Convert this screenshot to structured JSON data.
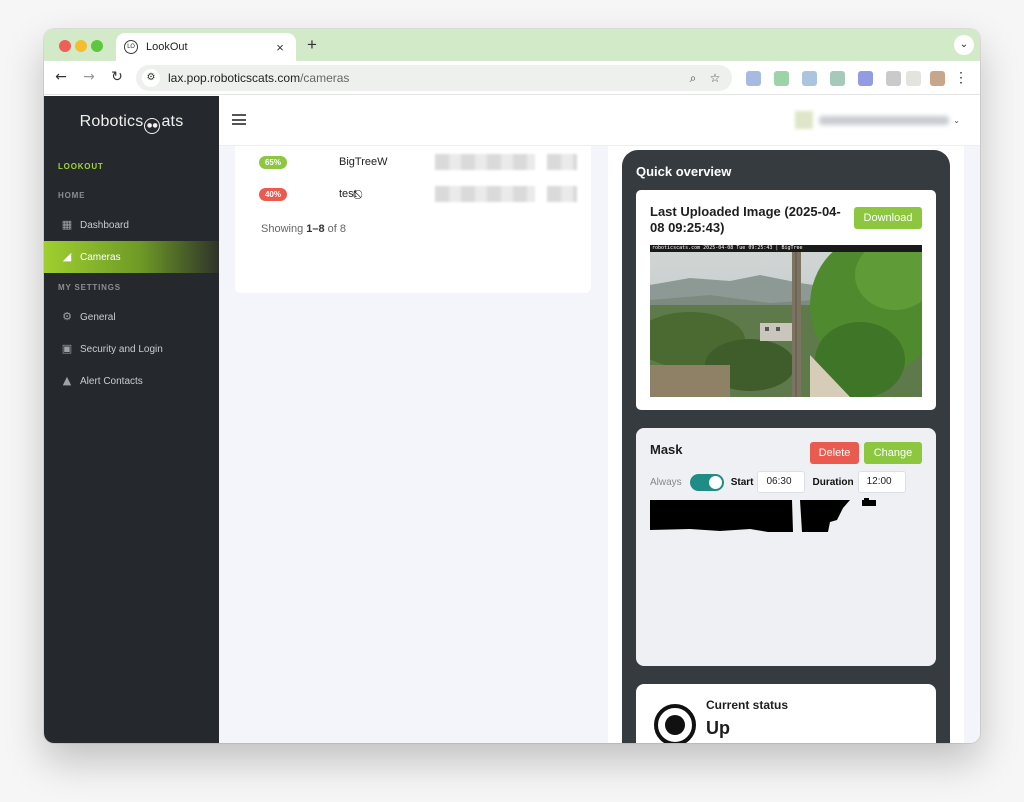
{
  "browser": {
    "tab_title": "LookOut",
    "favicon_text": "LO",
    "tab_close": "×",
    "new_tab": "+",
    "url_host": "lax.pop.roboticscats.com",
    "url_path": "/cameras",
    "menu_glyph": "⋮",
    "tab_menu_glyph": "⌄"
  },
  "sidebar": {
    "brand_left": "Robotics",
    "brand_logo": "cat",
    "brand_right": "ats",
    "app_label": "LOOKOUT",
    "section_home": "HOME",
    "section_settings": "MY SETTINGS",
    "items": [
      {
        "label": "Dashboard",
        "icon": "dashboard-icon"
      },
      {
        "label": "Cameras",
        "icon": "camera-icon",
        "active": true
      },
      {
        "label": "General",
        "icon": "gear-icon"
      },
      {
        "label": "Security and Login",
        "icon": "lock-icon"
      },
      {
        "label": "Alert Contacts",
        "icon": "bell-icon"
      }
    ]
  },
  "table": {
    "rows": [
      {
        "badge": "65%",
        "badge_color": "#8dc63f",
        "name": "BigTreeW",
        "disabled": false
      },
      {
        "badge": "40%",
        "badge_color": "#ea5b4f",
        "name": "test",
        "disabled": true
      }
    ],
    "showing_prefix": "Showing ",
    "showing_range": "1–8",
    "showing_suffix": " of 8"
  },
  "overview": {
    "title": "Quick overview",
    "last_image": {
      "title": "Last Uploaded Image (2025-04-08 09:25:43)",
      "download_label": "Download",
      "overlay_text": "roboticscats.com 2025-04-08 Tue 09:25:43 | BigTree"
    },
    "mask": {
      "title": "Mask",
      "delete_label": "Delete",
      "change_label": "Change",
      "always_label": "Always",
      "always_on": true,
      "start_label": "Start",
      "start_value": "06:30",
      "duration_label": "Duration",
      "duration_value": "12:00"
    },
    "status": {
      "label": "Current status",
      "value": "Up"
    }
  },
  "colors": {
    "accent": "#8dc63f",
    "danger": "#ea5b4f",
    "sidebar_bg": "#25282c",
    "toggle": "#1f8c86"
  }
}
